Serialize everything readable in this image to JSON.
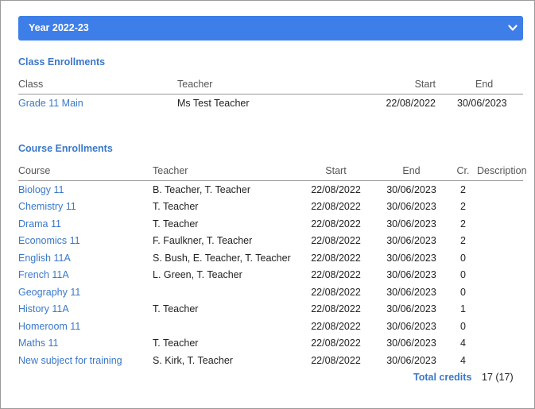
{
  "year_select": {
    "value": "Year 2022-23"
  },
  "class_enrollments": {
    "title": "Class Enrollments",
    "headers": {
      "class": "Class",
      "teacher": "Teacher",
      "start": "Start",
      "end": "End"
    },
    "rows": [
      {
        "class": "Grade 11 Main",
        "teacher": "Ms Test Teacher",
        "start": "22/08/2022",
        "end": "30/06/2023"
      }
    ]
  },
  "course_enrollments": {
    "title": "Course Enrollments",
    "headers": {
      "course": "Course",
      "teacher": "Teacher",
      "start": "Start",
      "end": "End",
      "cr": "Cr.",
      "description": "Description"
    },
    "rows": [
      {
        "course": "Biology 11",
        "teacher": "B. Teacher, T. Teacher",
        "start": "22/08/2022",
        "end": "30/06/2023",
        "cr": "2",
        "description": ""
      },
      {
        "course": "Chemistry 11",
        "teacher": "T. Teacher",
        "start": "22/08/2022",
        "end": "30/06/2023",
        "cr": "2",
        "description": ""
      },
      {
        "course": "Drama 11",
        "teacher": "T. Teacher",
        "start": "22/08/2022",
        "end": "30/06/2023",
        "cr": "2",
        "description": ""
      },
      {
        "course": "Economics 11",
        "teacher": "F. Faulkner, T. Teacher",
        "start": "22/08/2022",
        "end": "30/06/2023",
        "cr": "2",
        "description": ""
      },
      {
        "course": "English 11A",
        "teacher": "S. Bush, E. Teacher, T. Teacher",
        "start": "22/08/2022",
        "end": "30/06/2023",
        "cr": "0",
        "description": ""
      },
      {
        "course": "French 11A",
        "teacher": "L. Green, T. Teacher",
        "start": "22/08/2022",
        "end": "30/06/2023",
        "cr": "0",
        "description": ""
      },
      {
        "course": "Geography 11",
        "teacher": "",
        "start": "22/08/2022",
        "end": "30/06/2023",
        "cr": "0",
        "description": ""
      },
      {
        "course": "History 11A",
        "teacher": "T. Teacher",
        "start": "22/08/2022",
        "end": "30/06/2023",
        "cr": "1",
        "description": ""
      },
      {
        "course": "Homeroom 11",
        "teacher": "",
        "start": "22/08/2022",
        "end": "30/06/2023",
        "cr": "0",
        "description": ""
      },
      {
        "course": "Maths 11",
        "teacher": "T. Teacher",
        "start": "22/08/2022",
        "end": "30/06/2023",
        "cr": "4",
        "description": ""
      },
      {
        "course": "New subject for training",
        "teacher": "S. Kirk, T. Teacher",
        "start": "22/08/2022",
        "end": "30/06/2023",
        "cr": "4",
        "description": ""
      }
    ],
    "total_label": "Total credits",
    "total_value": "17 (17)"
  },
  "colors": {
    "accent": "#3d7ee8",
    "link": "#3a78c8",
    "border": "#9a9a9a"
  },
  "icons": {
    "year_select_arrow": "chevron-down-icon"
  }
}
